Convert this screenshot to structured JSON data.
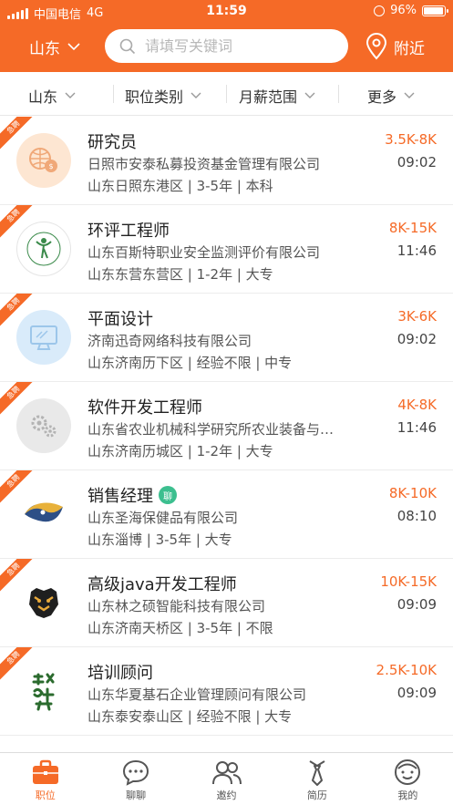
{
  "status_bar": {
    "carrier": "中国电信",
    "network": "4G",
    "time": "11:59",
    "battery": "96%",
    "battery_level": 0.96
  },
  "header": {
    "city": "山东",
    "search_placeholder": "请填写关键词",
    "nearby": "附近"
  },
  "filters": [
    "山东",
    "职位类别",
    "月薪范围",
    "更多"
  ],
  "urgent_label": "急聘",
  "chat_badge": "聊",
  "jobs": [
    {
      "title": "研究员",
      "company": "日照市安泰私募投资基金管理有限公司",
      "meta": "山东日照东港区 | 3-5年 | 本科",
      "salary": "3.5K-8K",
      "time": "09:02",
      "logo_icon": "globe-coin-icon"
    },
    {
      "title": "环评工程师",
      "company": "山东百斯特职业安全监测评价有限公司",
      "meta": "山东东营东营区 | 1-2年 | 大专",
      "salary": "8K-15K",
      "time": "11:46",
      "logo_icon": "figure-logo-icon"
    },
    {
      "title": "平面设计",
      "company": "济南迅奇网络科技有限公司",
      "meta": "山东济南历下区 | 经验不限 | 中专",
      "salary": "3K-6K",
      "time": "09:02",
      "logo_icon": "monitor-icon"
    },
    {
      "title": "软件开发工程师",
      "company": "山东省农业机械科学研究所农业装备与…",
      "meta": "山东济南历城区 | 1-2年 | 大专",
      "salary": "4K-8K",
      "time": "11:46",
      "logo_icon": "gears-icon"
    },
    {
      "title": "销售经理",
      "company": "山东圣海保健品有限公司",
      "meta": "山东淄博 | 3-5年 | 大专",
      "salary": "8K-10K",
      "time": "08:10",
      "logo_icon": "yinyang-logo-icon",
      "chat": true
    },
    {
      "title": "高级java开发工程师",
      "company": "山东林之硕智能科技有限公司",
      "meta": "山东济南天桥区 | 3-5年 | 不限",
      "salary": "10K-15K",
      "time": "09:09",
      "logo_icon": "tiger-logo-icon"
    },
    {
      "title": "培训顾问",
      "company": "山东华夏基石企业管理顾问有限公司",
      "meta": "山东泰安泰山区 | 经验不限 | 大专",
      "salary": "2.5K-10K",
      "time": "09:09",
      "logo_icon": "calligraphy-logo-icon"
    }
  ],
  "tabs": [
    {
      "label": "职位",
      "icon": "briefcase-icon",
      "active": true
    },
    {
      "label": "聊聊",
      "icon": "chat-bubble-icon"
    },
    {
      "label": "邀约",
      "icon": "people-icon"
    },
    {
      "label": "简历",
      "icon": "tie-icon"
    },
    {
      "label": "我的",
      "icon": "face-icon"
    }
  ],
  "colors": {
    "accent": "#f56a27",
    "chat_badge": "#3cbf8f"
  }
}
